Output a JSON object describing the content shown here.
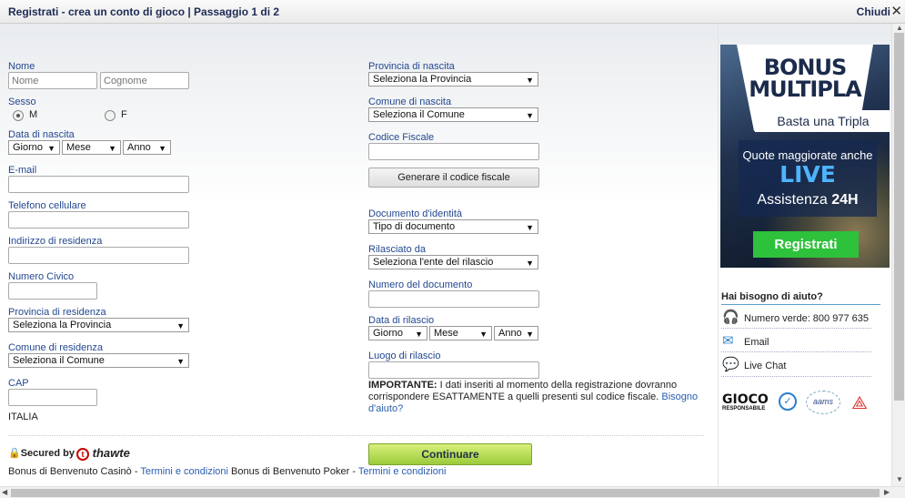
{
  "window": {
    "title": "Registrati - crea un conto di gioco | Passaggio 1 di 2",
    "close_label": "Chiudi",
    "close_icon": "close-icon"
  },
  "left": {
    "nome_label": "Nome",
    "nome_placeholder": "Nome",
    "cognome_placeholder": "Cognome",
    "sesso_label": "Sesso",
    "sesso_m": "M",
    "sesso_f": "F",
    "data_label": "Data di nascita",
    "giorno": "Giorno",
    "mese": "Mese",
    "anno": "Anno",
    "email_label": "E-mail",
    "telefono_label": "Telefono cellulare",
    "indirizzo_label": "Indirizzo di residenza",
    "civico_label": "Numero Civico",
    "provincia_label": "Provincia di residenza",
    "provincia_value": "Seleziona la Provincia",
    "comune_label": "Comune di residenza",
    "comune_value": "Seleziona il Comune",
    "cap_label": "CAP",
    "country": "ITALIA"
  },
  "right": {
    "prov_nascita_label": "Provincia di nascita",
    "prov_nascita_value": "Seleziona la Provincia",
    "com_nascita_label": "Comune di nascita",
    "com_nascita_value": "Seleziona il Comune",
    "cf_label": "Codice Fiscale",
    "cf_button": "Generare il codice fiscale",
    "doc_label": "Documento d'identità",
    "doc_value": "Tipo di documento",
    "rilasciato_label": "Rilasciato da",
    "rilasciato_value": "Seleziona l'ente del rilascio",
    "num_doc_label": "Numero del documento",
    "data_ril_label": "Data di rilascio",
    "giorno": "Giorno",
    "mese": "Mese",
    "anno": "Anno",
    "luogo_label": "Luogo di rilascio",
    "important_bold": "IMPORTANTE:",
    "important_text": " I dati inseriti al momento della registrazione dovranno corrispondere ESATTAMENTE a quelli presenti sul codice fiscale. ",
    "help_link": "Bisogno d'aiuto?"
  },
  "footer": {
    "secured_by": "Secured by",
    "thawte": "thawte",
    "continue_button": "Continuare",
    "casino_text": "Bonus di Benvenuto Casinò - ",
    "casino_link": "Termini e condizioni",
    "poker_text": " Bonus di Benvenuto Poker - ",
    "poker_link": "Termini e condizioni"
  },
  "banner": {
    "line1": "BONUS",
    "line2": "MULTIPLA",
    "tagline": "Basta una Tripla",
    "quote": "Quote maggiorate anche",
    "live": "LIVE",
    "assist": "Assistenza",
    "assist_bold": "24H",
    "button": "Registrati"
  },
  "help": {
    "title": "Hai bisogno di aiuto?",
    "phone": "Numero verde: 800 977 635",
    "email": "Email",
    "chat": "Live Chat"
  },
  "logos": {
    "gioco": "GIOCO",
    "responsabile": "RESPONSABILE",
    "aams": "aams"
  },
  "colors": {
    "label": "#24488f",
    "link": "#2a5db0",
    "green_button": "#9bcb3b",
    "banner_green": "#2ec13b"
  }
}
